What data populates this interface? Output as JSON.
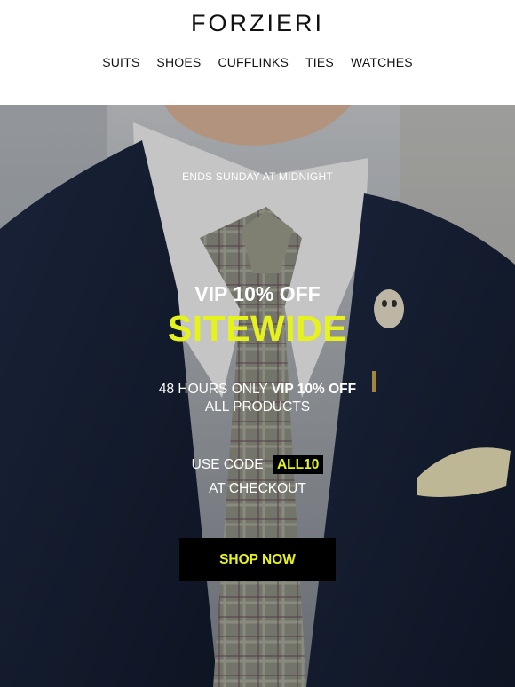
{
  "brand": {
    "logo": "FORZIERI"
  },
  "nav": {
    "items": [
      {
        "label": "SUITS"
      },
      {
        "label": "SHOES"
      },
      {
        "label": "CUFFLINKS"
      },
      {
        "label": "TIES"
      },
      {
        "label": "WATCHES"
      }
    ]
  },
  "hero": {
    "urgency": "ENDS SUNDAY AT MIDNIGHT",
    "headline": "VIP 10% OFF",
    "headline_highlight": "SITEWIDE",
    "offer_prefix": "48 HOURS ONLY",
    "offer_bold": "VIP 10% OFF",
    "offer_line2": "ALL PRODUCTS",
    "code_prefix": "USE CODE",
    "code": "ALL10",
    "code_suffix": "AT CHECKOUT",
    "cta_label": "SHOP NOW"
  },
  "colors": {
    "accent": "#e6f21c",
    "cta_background": "#000000",
    "text_light": "#ffffff"
  }
}
